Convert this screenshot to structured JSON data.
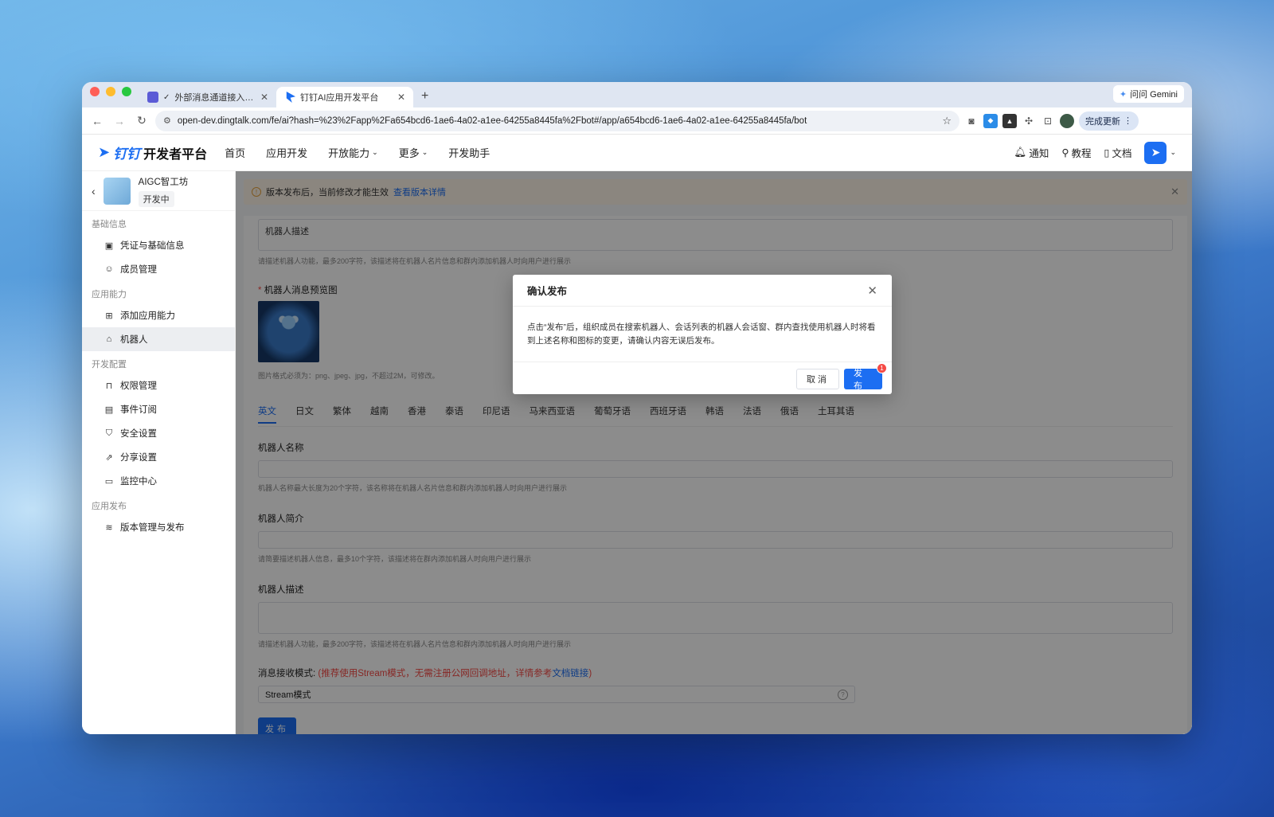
{
  "browser": {
    "tabs": [
      {
        "title": "外部消息通道接入配置指南",
        "prefix": "✓",
        "active": false,
        "favicon_color": "#5b5bd6"
      },
      {
        "title": "钉钉AI应用开发平台",
        "active": true,
        "favicon_color": "#1c6ef2"
      }
    ],
    "new_tab": "+",
    "gemini_label": "问问 Gemini",
    "url": "open-dev.dingtalk.com/fe/ai?hash=%23%2Fapp%2Fa654bcd6-1ae6-4a02-a1ee-64255a8445fa%2Fbot#/app/a654bcd6-1ae6-4a02-a1ee-64255a8445fa/bot",
    "update_label": "完成更新"
  },
  "header": {
    "logo_mark": "钉钉",
    "logo_text": "开发者平台",
    "nav": [
      "首页",
      "应用开发",
      "开放能力",
      "更多",
      "开发助手"
    ],
    "notify": "通知",
    "tutorial": "教程",
    "docs": "文档"
  },
  "sidebar": {
    "app_name": "AIGC智工坊",
    "app_status": "开发中",
    "groups": [
      {
        "title": "基础信息",
        "items": [
          {
            "label": "凭证与基础信息",
            "icon": "credential-icon"
          },
          {
            "label": "成员管理",
            "icon": "user-icon"
          }
        ]
      },
      {
        "title": "应用能力",
        "items": [
          {
            "label": "添加应用能力",
            "icon": "grid-add-icon"
          },
          {
            "label": "机器人",
            "icon": "robot-icon",
            "active": true
          }
        ]
      },
      {
        "title": "开发配置",
        "items": [
          {
            "label": "权限管理",
            "icon": "lock-icon"
          },
          {
            "label": "事件订阅",
            "icon": "event-icon"
          },
          {
            "label": "安全设置",
            "icon": "shield-icon"
          },
          {
            "label": "分享设置",
            "icon": "share-icon"
          },
          {
            "label": "监控中心",
            "icon": "monitor-icon"
          }
        ]
      },
      {
        "title": "应用发布",
        "items": [
          {
            "label": "版本管理与发布",
            "icon": "layers-icon"
          }
        ]
      }
    ]
  },
  "notice": {
    "text": "版本发布后，当前修改才能生效",
    "link": "查看版本详情"
  },
  "form": {
    "top_description_value": "机器人描述",
    "top_description_hint": "请描述机器人功能，最多200字符，该描述将在机器人名片信息和群内添加机器人时向用户进行展示",
    "preview_label": "机器人消息预览图",
    "preview_hint": "图片格式必须为：png、jpeg、jpg，不超过2M，可修改。",
    "lang_tabs": [
      "英文",
      "日文",
      "繁体",
      "越南",
      "香港",
      "泰语",
      "印尼语",
      "马来西亚语",
      "葡萄牙语",
      "西班牙语",
      "韩语",
      "法语",
      "俄语",
      "土耳其语"
    ],
    "name_label": "机器人名称",
    "name_hint": "机器人名称最大长度为20个字符，该名称将在机器人名片信息和群内添加机器人时向用户进行展示",
    "intro_label": "机器人简介",
    "intro_hint": "请简要描述机器人信息，最多10个字符，该描述将在群内添加机器人时向用户进行展示",
    "desc_label": "机器人描述",
    "desc_hint": "请描述机器人功能，最多200字符，该描述将在机器人名片信息和群内添加机器人时向用户进行展示",
    "mode_label": "消息接收模式:",
    "mode_note": "(推荐使用Stream模式，无需注册公网回调地址，详情参考",
    "mode_link": "文档链接",
    "mode_note_end": ")",
    "mode_value": "Stream模式",
    "publish_label": "发布"
  },
  "modal": {
    "title": "确认发布",
    "body": "点击“发布”后，组织成员在搜索机器人、会话列表的机器人会话窗、群内查找使用机器人时将看到上述名称和图标的变更，请确认内容无误后发布。",
    "cancel": "取消",
    "confirm": "发布",
    "badge": "1"
  }
}
